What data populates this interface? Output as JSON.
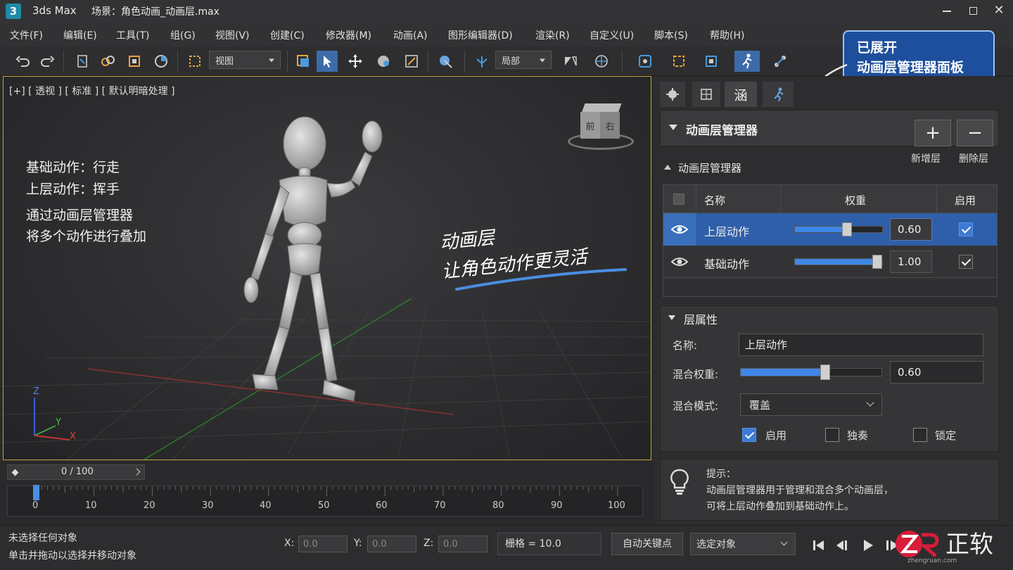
{
  "window": {
    "app_icon": "3",
    "app_name": "3ds Max",
    "scene_label": "场景：角色动画_动画层.max",
    "minimize_icon": "minimize-icon",
    "maximize_icon": "maximize-icon",
    "close_icon": "close-icon"
  },
  "menu": [
    "文件(F)",
    "编辑(E)",
    "工具(T)",
    "组(G)",
    "视图(V)",
    "创建(C)",
    "修改器(M)",
    "动画(A)",
    "图形编辑器(D)",
    "渲染(R)",
    "自定义(U)",
    "脚本(S)",
    "帮助(H)"
  ],
  "toolbar": {
    "view_dropdown": "视图",
    "coord_dropdown": "局部"
  },
  "callout": {
    "line1": "已展开",
    "line2": "动画层管理器面板"
  },
  "viewport": {
    "label": "[+] [ 透视 ] [ 标准 ] [ 默认明暗处理 ]",
    "cube_front": "前",
    "cube_right": "右",
    "note1": "基础动作：行走",
    "note2": "上层动作：挥手",
    "note3": "通过动画层管理器",
    "note4": "将多个动作进行叠加",
    "slogan1": "动画层",
    "slogan2": "让角色动作更灵活",
    "axis_z": "Z",
    "axis_y": "Y",
    "axis_x": "X"
  },
  "panel": {
    "tab_active_glyph": "涵",
    "rollout_title": "动画层管理器",
    "add_layer_label": "新增层",
    "delete_layer_label": "删除层",
    "sub_title": "动画层管理器",
    "table_headers": [
      "名称",
      "权重",
      "启用"
    ],
    "layers": [
      {
        "name": "上层动作",
        "weight": 0.6,
        "weight_text": "0.60",
        "enabled": true,
        "selected": true
      },
      {
        "name": "基础动作",
        "weight": 1.0,
        "weight_text": "1.00",
        "enabled": true,
        "selected": false
      }
    ],
    "props_title": "层属性",
    "name_label": "名称:",
    "name_value": "上层动作",
    "blend_weight_label": "混合权重:",
    "blend_weight_value": "0.60",
    "blend_weight": 0.6,
    "blend_mode_label": "混合模式:",
    "blend_mode_value": "覆盖",
    "opt_enable": "启用",
    "opt_solo": "独奏",
    "opt_lock": "锁定",
    "tip_title": "提示：",
    "tip_line1": "动画层管理器用于管理和混合多个动画层，",
    "tip_line2": "可将上层动作叠加到基础动作上。"
  },
  "timeline": {
    "frame_counter": "0 / 100",
    "ticks": [
      "0",
      "10",
      "20",
      "30",
      "40",
      "50",
      "60",
      "70",
      "80",
      "90",
      "100"
    ]
  },
  "status": {
    "line1": "未选择任何对象",
    "line2": "单击并拖动以选择并移动对象",
    "x_label": "X:",
    "x_value": "0.0",
    "y_label": "Y:",
    "y_value": "0.0",
    "z_label": "Z:",
    "z_value": "0.0",
    "grid": "栅格 = 10.0",
    "auto_key": "自动关键点",
    "sel_set": "选定对象",
    "watermark_text": "正软",
    "watermark_url": "zhengruan.com"
  }
}
